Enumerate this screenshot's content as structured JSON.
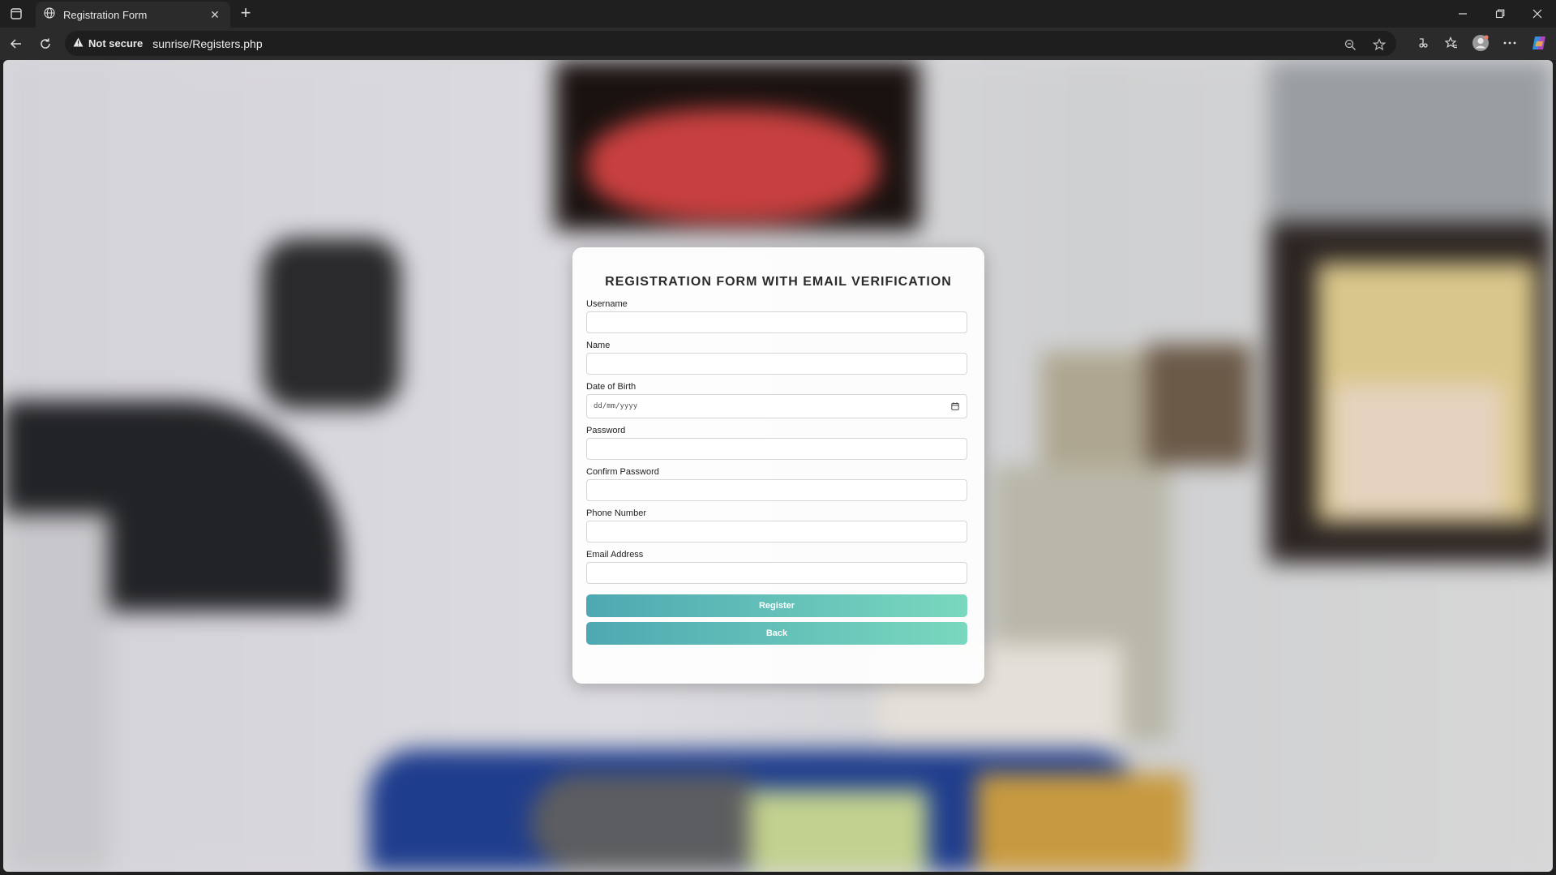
{
  "browser": {
    "tab_title": "Registration Form",
    "security_label": "Not secure",
    "url": "sunrise/Registers.php"
  },
  "form": {
    "title": "REGISTRATION FORM WITH EMAIL VERIFICATION",
    "fields": {
      "username": {
        "label": "Username",
        "value": ""
      },
      "name": {
        "label": "Name",
        "value": ""
      },
      "dob": {
        "label": "Date of Birth",
        "placeholder": "dd/mm/yyyy"
      },
      "password": {
        "label": "Password",
        "value": ""
      },
      "confirm_password": {
        "label": "Confirm Password",
        "value": ""
      },
      "phone": {
        "label": "Phone Number",
        "value": ""
      },
      "email": {
        "label": "Email Address",
        "value": ""
      }
    },
    "register_label": "Register",
    "back_label": "Back"
  },
  "colors": {
    "button_gradient_start": "#4ea8b2",
    "button_gradient_end": "#79d8be",
    "chrome_dark": "#1f1f1f"
  }
}
